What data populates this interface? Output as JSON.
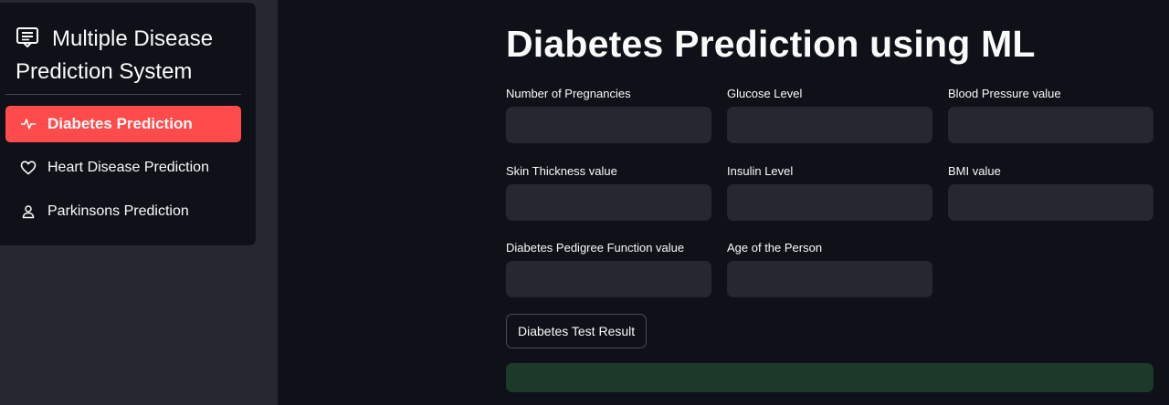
{
  "sidebar": {
    "menu_title": "Multiple Disease Prediction System",
    "menu_icon": "list-alt-icon",
    "items": [
      {
        "label": "Diabetes Prediction",
        "icon": "activity-icon",
        "active": true
      },
      {
        "label": "Heart Disease Prediction",
        "icon": "heart-icon",
        "active": false
      },
      {
        "label": "Parkinsons Prediction",
        "icon": "person-icon",
        "active": false
      }
    ]
  },
  "main": {
    "title": "Diabetes Prediction using ML",
    "fields": [
      {
        "label": "Number of Pregnancies",
        "value": ""
      },
      {
        "label": "Glucose Level",
        "value": ""
      },
      {
        "label": "Blood Pressure value",
        "value": ""
      },
      {
        "label": "Skin Thickness value",
        "value": ""
      },
      {
        "label": "Insulin Level",
        "value": ""
      },
      {
        "label": "BMI value",
        "value": ""
      },
      {
        "label": "Diabetes Pedigree Function value",
        "value": ""
      },
      {
        "label": "Age of the Person",
        "value": ""
      }
    ],
    "submit_label": "Diabetes Test Result",
    "result_text": ""
  },
  "colors": {
    "accent": "#ff4b4b",
    "background": "#0e1117",
    "sidebar": "#262730",
    "input_bg": "#262730",
    "result_bg": "#1b3a2a"
  }
}
